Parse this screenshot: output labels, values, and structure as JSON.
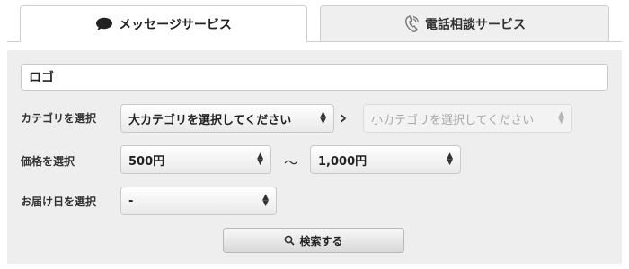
{
  "tabs": [
    {
      "label": "メッセージサービス",
      "icon": "speech-bubble-icon",
      "active": true
    },
    {
      "label": "電話相談サービス",
      "icon": "phone-icon",
      "active": false
    }
  ],
  "search": {
    "value": "ロゴ"
  },
  "category": {
    "label": "カテゴリを選択",
    "major": "大カテゴリを選択してください",
    "minor": "小カテゴリを選択してください"
  },
  "price": {
    "label": "価格を選択",
    "min": "500円",
    "separator": "〜",
    "max": "1,000円"
  },
  "delivery": {
    "label": "お届け日を選択",
    "value": "-"
  },
  "button": {
    "label": "検索する",
    "icon": "magnifier-icon"
  },
  "colors": {
    "panel": "#eeeeee",
    "border": "#c8c8c8"
  }
}
